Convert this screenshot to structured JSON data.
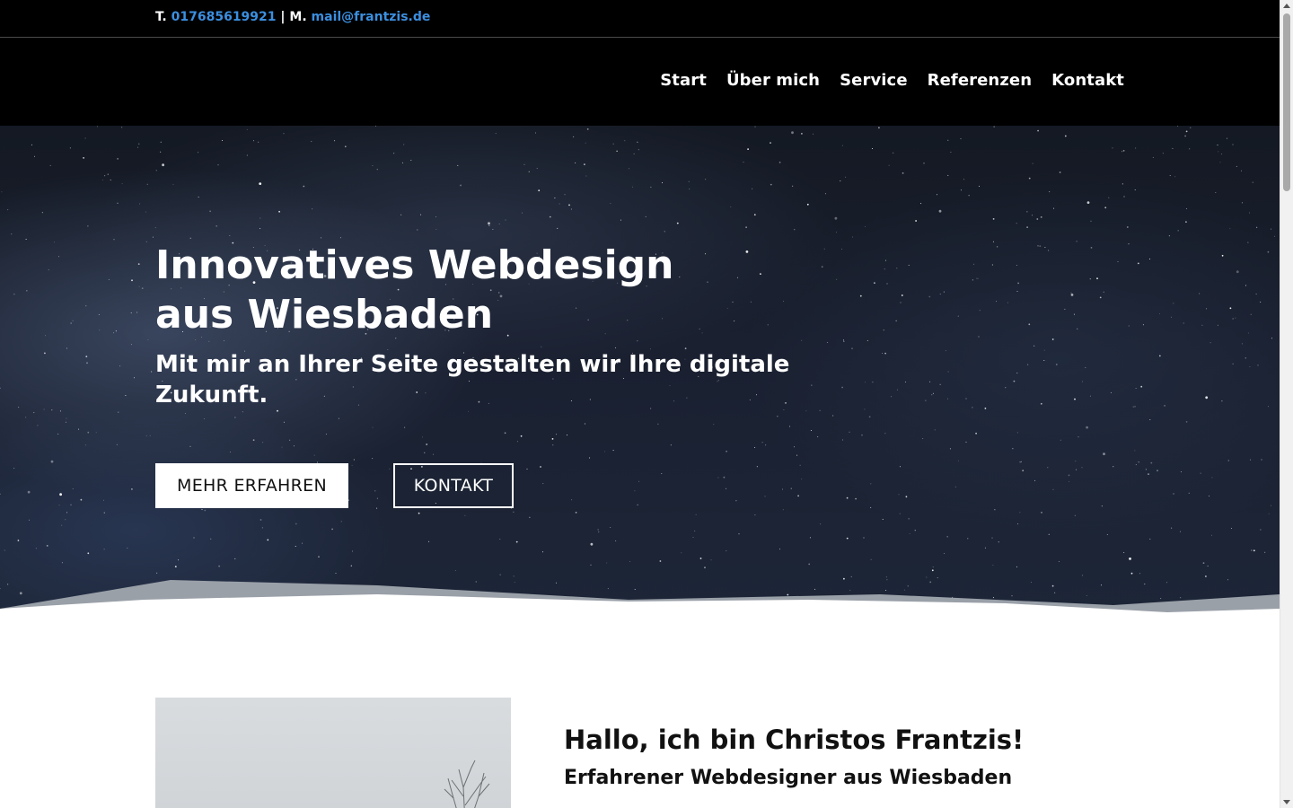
{
  "topbar": {
    "phone_prefix": "T.",
    "phone": "017685619921",
    "separator": "|",
    "mail_prefix": "M.",
    "email": "mail@frantzis.de"
  },
  "nav": {
    "items": [
      {
        "label": "Start"
      },
      {
        "label": "Über mich"
      },
      {
        "label": "Service"
      },
      {
        "label": "Referenzen"
      },
      {
        "label": "Kontakt"
      }
    ]
  },
  "hero": {
    "title_line1": "Innovatives Webdesign",
    "title_line2": "aus Wiesbaden",
    "subtitle": "Mit mir an Ihrer Seite gestalten wir Ihre digitale Zukunft.",
    "primary_button": "MEHR ERFAHREN",
    "secondary_button": "KONTAKT"
  },
  "about": {
    "heading": "Hallo, ich bin Christos Frantzis!",
    "subheading": "Erfahrener Webdesigner aus Wiesbaden"
  },
  "colors": {
    "header_bg": "#000000",
    "link_blue": "#3b8fe0",
    "hero_bg": "#1a2030",
    "text_light": "#ffffff",
    "text_dark": "#111111"
  }
}
